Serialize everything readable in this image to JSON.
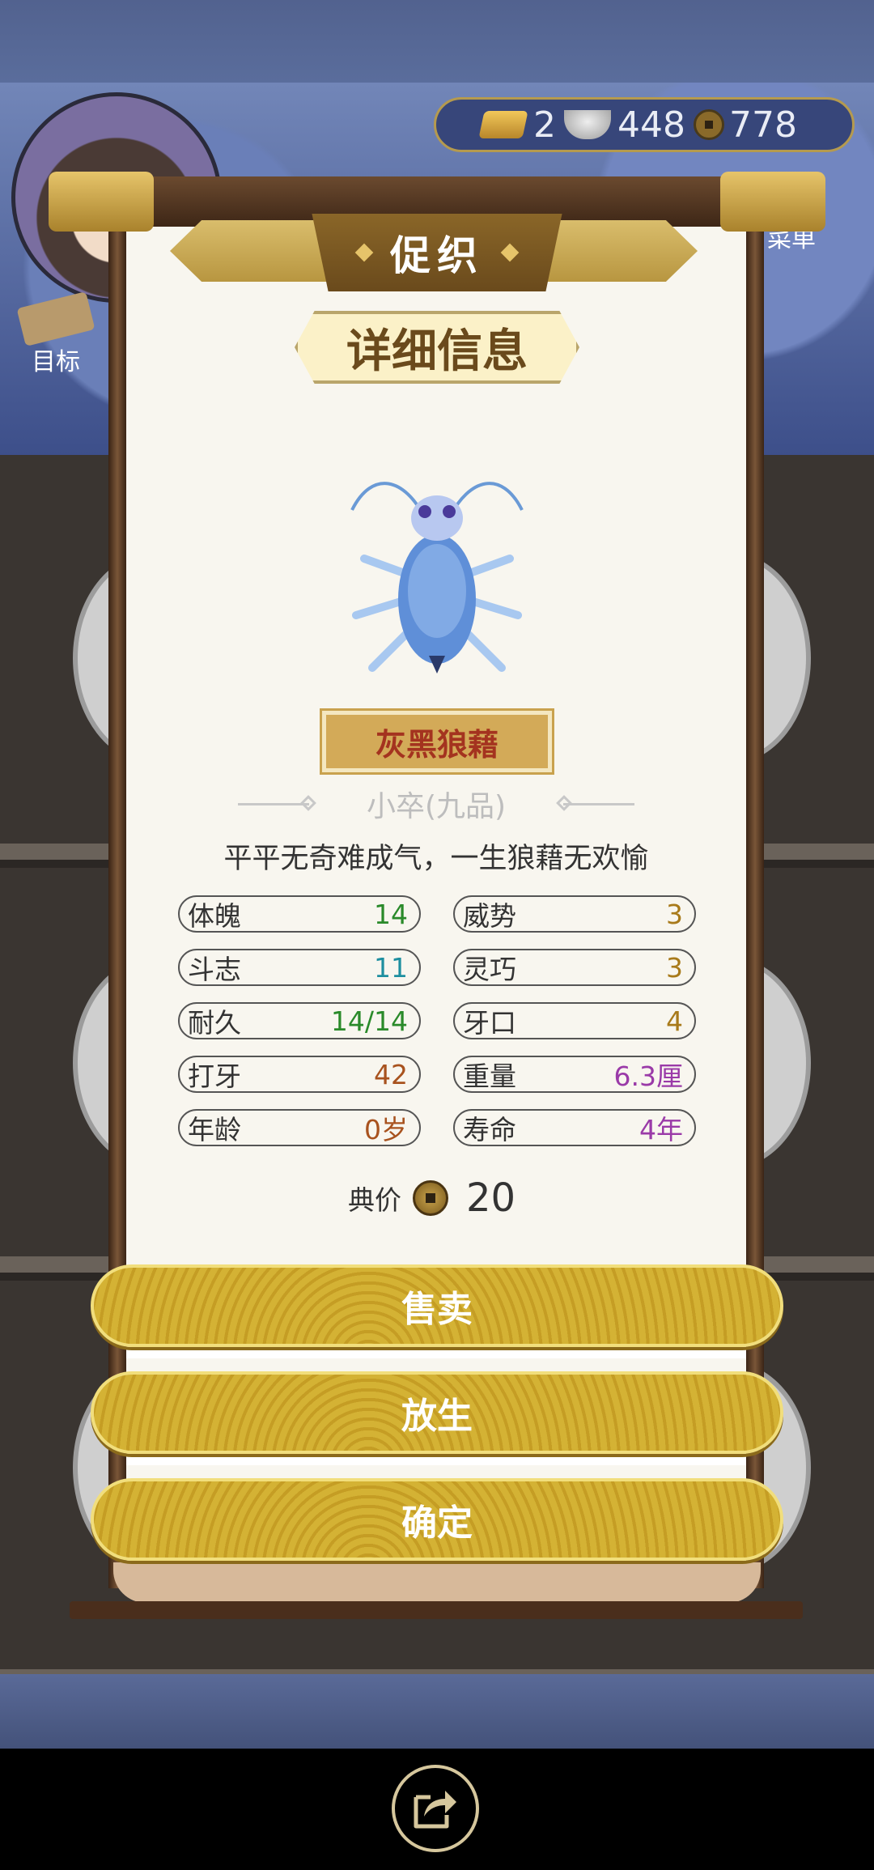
{
  "currency": {
    "gold": "2",
    "silver": "448",
    "copper": "778"
  },
  "side": {
    "goal_label": "目标",
    "menu_label": "菜单"
  },
  "dialog": {
    "title": "促织",
    "subtitle": "详细信息",
    "cricket_name": "灰黑狼藉",
    "rank": "小卒(九品)",
    "description": "平平无奇难成气，一生狼藉无欢愉",
    "stats": [
      {
        "label": "体魄",
        "value": "14",
        "color": "#2a8a2a"
      },
      {
        "label": "威势",
        "value": "3",
        "color": "#a87a1a"
      },
      {
        "label": "斗志",
        "value": "11",
        "color": "#1e8fa0"
      },
      {
        "label": "灵巧",
        "value": "3",
        "color": "#a87a1a"
      },
      {
        "label": "耐久",
        "value": "14/14",
        "color": "#2a8a2a"
      },
      {
        "label": "牙口",
        "value": "4",
        "color": "#a87a1a"
      },
      {
        "label": "打牙",
        "value": "42",
        "color": "#a8521e"
      },
      {
        "label": "重量",
        "value": "6.3厘",
        "color": "#9a3aa8"
      },
      {
        "label": "年龄",
        "value": "0岁",
        "color": "#a8521e"
      },
      {
        "label": "寿命",
        "value": "4年",
        "color": "#9a3aa8"
      }
    ],
    "price_label": "典价",
    "price_value": "20",
    "buttons": {
      "sell": "售卖",
      "release": "放生",
      "confirm": "确定"
    }
  },
  "icons": [
    "gold-bar-icon",
    "silver-ingot-icon",
    "copper-coin-icon",
    "scroll-icon",
    "share-icon"
  ]
}
